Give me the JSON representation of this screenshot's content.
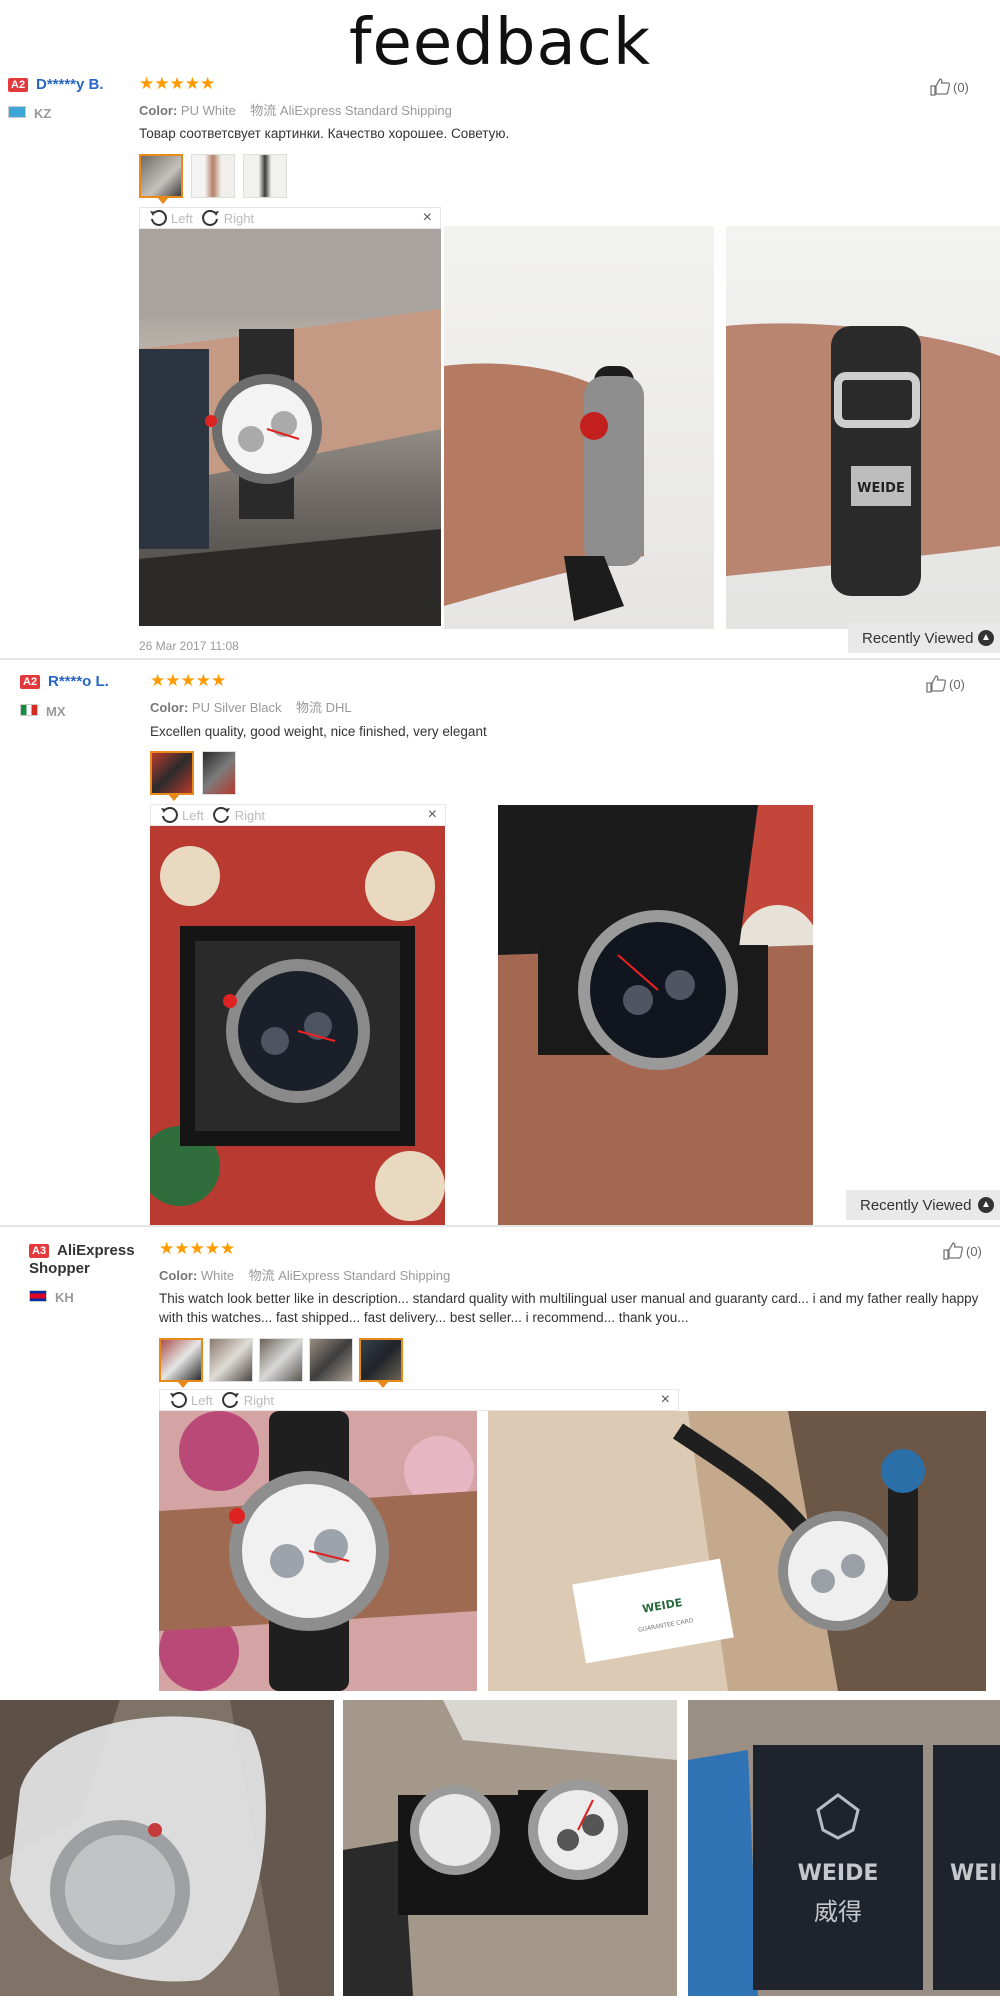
{
  "page_title": "feedback",
  "reviews": [
    {
      "badge": "A2",
      "user": "D*****y B.",
      "country": "KZ",
      "color_label": "Color:",
      "color": "PU White",
      "shipping_label": "物流",
      "shipping": "AliExpress Standard Shipping",
      "comment": "Товар соответсвует картинки. Качество хорошее. Советую.",
      "helpful_count": "(0)",
      "date": "26 Mar 2017 11:08",
      "rotate_left": "Left",
      "rotate_right": "Right",
      "close": "×"
    },
    {
      "badge": "A2",
      "user": "R****o L.",
      "country": "MX",
      "color_label": "Color:",
      "color": "PU Silver Black",
      "shipping_label": "物流",
      "shipping": "DHL",
      "comment": "Excellen quality, good weight, nice finished, very elegant",
      "helpful_count": "(0)",
      "rotate_left": "Left",
      "rotate_right": "Right",
      "close": "×"
    },
    {
      "badge": "A3",
      "user": "AliExpress Shopper",
      "country": "KH",
      "color_label": "Color:",
      "color": "White",
      "shipping_label": "物流",
      "shipping": "AliExpress Standard Shipping",
      "comment": "This watch look better like in description... standard quality with multilingual user manual and guaranty card... i and my father really happy with this watches... fast shipped... fast delivery... best seller... i recommend... thank you...",
      "helpful_count": "(0)",
      "rotate_left": "Left",
      "rotate_right": "Right",
      "close": "×"
    }
  ],
  "recently_viewed": "Recently Viewed",
  "stars": "★★★★★",
  "photo_text": {
    "brand": "WEIDE",
    "brand_cn": "威得",
    "card_brand": "WEIDE",
    "card_sub": "GUARANTEE CARD"
  },
  "colors": {
    "star": "#ff9a00",
    "username": "#2865c5",
    "badge": "#e4393c",
    "active_thumb": "#e88a1a"
  }
}
